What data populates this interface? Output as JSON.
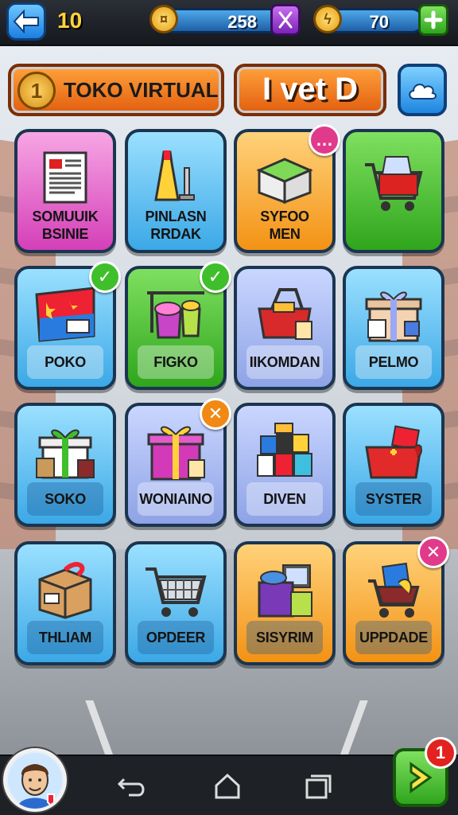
{
  "topbar": {
    "level": "10",
    "coins": "258",
    "energy": "70"
  },
  "header": {
    "store_badge": "1",
    "store_title": "TOKO VIRTUAL",
    "event_label": "I vet D"
  },
  "tiles": [
    {
      "label": "SOMUUIK BSINIE",
      "icon": "document-icon"
    },
    {
      "label": "PINLASN RRDAK",
      "icon": "bottle-icon"
    },
    {
      "label": "SYFOO MEN",
      "icon": "box-icon"
    },
    {
      "label": "",
      "icon": "shopping-cart-icon"
    },
    {
      "label": "POKO",
      "icon": "flag-banner-icon"
    },
    {
      "label": "FIGKO",
      "icon": "product-bundle-icon"
    },
    {
      "label": "IIKOMDAN",
      "icon": "basket-icon"
    },
    {
      "label": "PELMO",
      "icon": "gift-box-icon"
    },
    {
      "label": "SOKO",
      "icon": "gift-box-icon"
    },
    {
      "label": "WONIAINO",
      "icon": "gift-box-icon"
    },
    {
      "label": "DIVEN",
      "icon": "blocks-icon"
    },
    {
      "label": "SYSTER",
      "icon": "gift-basket-icon"
    },
    {
      "label": "THLIAM",
      "icon": "package-icon"
    },
    {
      "label": "OPDEER",
      "icon": "shopping-cart-icon"
    },
    {
      "label": "SISYRIM",
      "icon": "store-box-icon"
    },
    {
      "label": "UPPDADE",
      "icon": "shopping-cart-icon"
    }
  ],
  "nav": {
    "next_badge": "1"
  }
}
